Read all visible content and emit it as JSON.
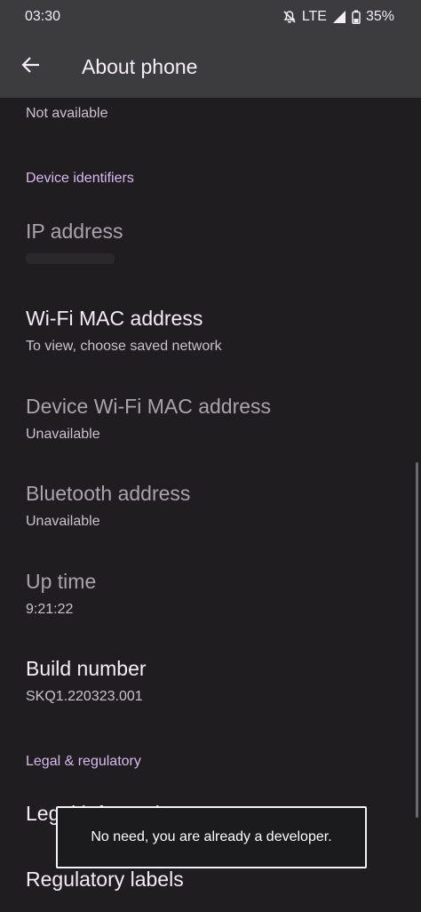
{
  "status": {
    "time": "03:30",
    "network": "LTE",
    "battery": "35%",
    "icons": [
      "silent-mode-icon",
      "signal-icon",
      "battery-icon"
    ]
  },
  "appbar": {
    "title": "About phone",
    "back_icon": "arrow-left-icon"
  },
  "top_summary": "Not available",
  "sections": {
    "device_identifiers": "Device identifiers",
    "legal_regulatory": "Legal & regulatory"
  },
  "items": {
    "ip_address": {
      "title": "IP address"
    },
    "wifi_mac": {
      "title": "Wi-Fi MAC address",
      "summary": "To view, choose saved network"
    },
    "device_wifi_mac": {
      "title": "Device Wi-Fi MAC address",
      "summary": "Unavailable"
    },
    "bluetooth": {
      "title": "Bluetooth address",
      "summary": "Unavailable"
    },
    "up_time": {
      "title": "Up time",
      "summary": "9:21:22"
    },
    "build_number": {
      "title": "Build number",
      "summary": "SKQ1.220323.001"
    },
    "legal_information": {
      "title": "Legal information"
    },
    "regulatory_labels": {
      "title": "Regulatory labels"
    }
  },
  "toast": {
    "message": "No need, you are already a developer."
  },
  "colors": {
    "background": "#1f1d20",
    "appbar": "#3c3b3d",
    "section_accent": "#d9b9f0"
  }
}
